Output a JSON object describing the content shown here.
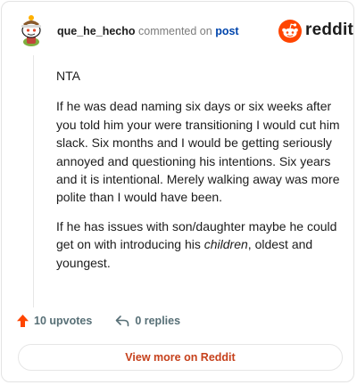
{
  "comment": {
    "username": "que_he_hecho",
    "action": "commented on",
    "link_text": "post",
    "paragraphs": {
      "p1": "NTA",
      "p2": "If he was dead naming six days or six weeks after you told him your were transitioning I would cut him slack. Six months and I would be getting seriously annoyed and questioning his intentions. Six years and it is intentional. Merely walking away was more polite than I would have been.",
      "p3_before": "If he has issues with son/daughter maybe he could get on with introducing his ",
      "p3_emphasis": "children",
      "p3_after": ", oldest and youngest."
    }
  },
  "brand": {
    "name": "reddit",
    "icon": "reddit-logo-icon",
    "color": "#ff4500"
  },
  "stats": {
    "upvotes_label": "10 upvotes",
    "replies_label": "0 replies",
    "upvote_icon": "upvote-arrow-icon",
    "reply_icon": "reply-arrow-icon",
    "upvote_color": "#ff4500"
  },
  "cta": {
    "label": "View more on Reddit",
    "color": "#c6411c"
  }
}
